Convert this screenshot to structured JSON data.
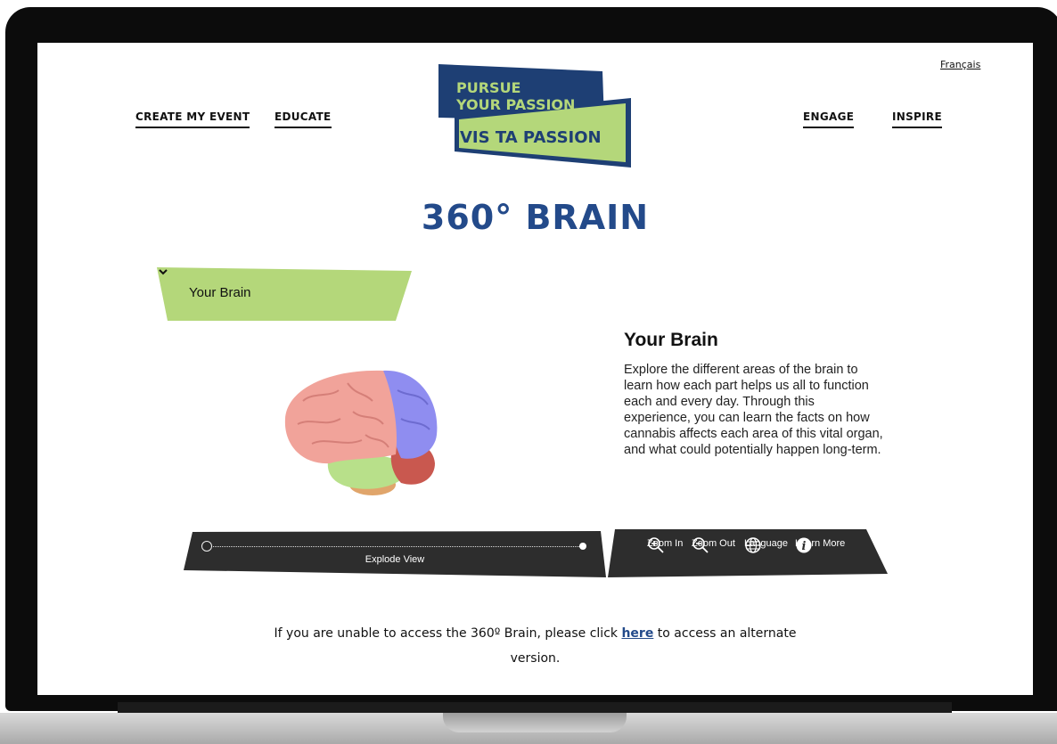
{
  "header": {
    "language_link": "Français",
    "nav_left": [
      "CREATE MY EVENT",
      "EDUCATE"
    ],
    "nav_right": [
      "ENGAGE",
      "INSPIRE"
    ]
  },
  "logo": {
    "line1": "PURSUE",
    "line2": "YOUR PASSION",
    "line3": "VIS TA PASSION",
    "colors": {
      "navy": "#1e3f74",
      "green": "#b4d77a"
    }
  },
  "main": {
    "title": "360° BRAIN",
    "dropdown": {
      "selected": "Your Brain",
      "icon": "chevron-down-icon"
    },
    "info_title": "Your Brain",
    "info_body": "Explore the different areas of the brain to learn how each part helps us all to function each and every day. Through this experience, you can learn the facts on how cannabis affects each area of this vital organ, and what could potentially happen long-term."
  },
  "controls": {
    "slider_label": "Explode View",
    "slider_value": 0,
    "zoom_in": "Zoom In",
    "zoom_out": "Zoom Out",
    "language": "Language",
    "learn_more": "Learn More"
  },
  "notice": {
    "before": "If you are unable to access the 360º Brain, please click",
    "link": "here",
    "after": "to access an alternate",
    "line2": "version."
  },
  "colors": {
    "title": "#234a8a",
    "dropdown_bg": "#b4d77a",
    "bar_bg": "#2d2d2d"
  }
}
